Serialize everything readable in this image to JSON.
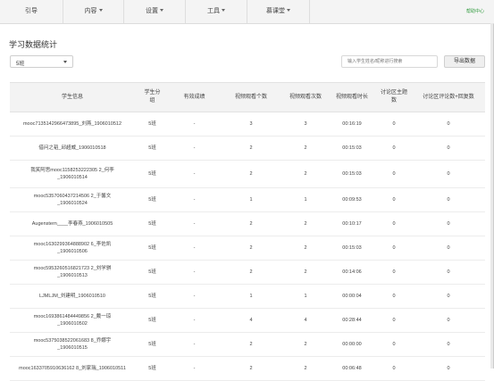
{
  "nav": {
    "items": [
      {
        "label": "引导",
        "dropdown": false
      },
      {
        "label": "内容",
        "dropdown": true
      },
      {
        "label": "设置",
        "dropdown": true
      },
      {
        "label": "工具",
        "dropdown": true
      },
      {
        "label": "慕课堂",
        "dropdown": true
      }
    ],
    "help": "帮助中心"
  },
  "page": {
    "title": "学习数据统计"
  },
  "filter": {
    "class_value": "5班",
    "search_placeholder": "输入学生姓名/昵称进行搜索",
    "export_label": "导出数据"
  },
  "table": {
    "headers": [
      "学生信息",
      "学生分组",
      "有效成绩",
      "视频观看个数",
      "视频观看次数",
      "视频观看时长",
      "讨论区主题数",
      "讨论区评论数+回复数"
    ],
    "rows": [
      {
        "info": "mooc7135142966473895_刘燕_1906010512",
        "group": "5班",
        "score": "-",
        "count": "3",
        "times": "3",
        "duration": "00:16:19",
        "topics": "0",
        "comments": "0"
      },
      {
        "info": "借问之韬_邱超威_1906010518",
        "group": "5班",
        "score": "-",
        "count": "2",
        "times": "2",
        "duration": "00:15:03",
        "topics": "0",
        "comments": "0"
      },
      {
        "info": "我笑阿思mooc1158253222305 2_何李_1906010514",
        "group": "5班",
        "score": "-",
        "count": "2",
        "times": "2",
        "duration": "00:15:03",
        "topics": "0",
        "comments": "0"
      },
      {
        "info": "mooc5357060437214506 2_于馨文_1906010524",
        "group": "5班",
        "score": "-",
        "count": "1",
        "times": "1",
        "duration": "00:09:53",
        "topics": "0",
        "comments": "0"
      },
      {
        "info": "Augenstern____李春燕_1906010505",
        "group": "5班",
        "score": "-",
        "count": "2",
        "times": "2",
        "duration": "00:10:17",
        "topics": "0",
        "comments": "0"
      },
      {
        "info": "mooc1630299364888902 6_李佐凯_1906010506",
        "group": "5班",
        "score": "-",
        "count": "2",
        "times": "2",
        "duration": "00:15:03",
        "topics": "0",
        "comments": "0"
      },
      {
        "info": "mooc5953260516821723 2_刘学骐_1906010513",
        "group": "5班",
        "score": "-",
        "count": "2",
        "times": "2",
        "duration": "00:14:06",
        "topics": "0",
        "comments": "0"
      },
      {
        "info": "LJMLJM_刘建明_1906010510",
        "group": "5班",
        "score": "-",
        "count": "1",
        "times": "1",
        "duration": "00:00:04",
        "topics": "0",
        "comments": "0"
      },
      {
        "info": "mooc1693861484449856 2_戴一琼_1906010502",
        "group": "5班",
        "score": "-",
        "count": "4",
        "times": "4",
        "duration": "00:28:44",
        "topics": "0",
        "comments": "0"
      },
      {
        "info": "mooc5375038522061683 8_乔娜宇_1906010515",
        "group": "5班",
        "score": "-",
        "count": "2",
        "times": "2",
        "duration": "00:00:00",
        "topics": "0",
        "comments": "0"
      },
      {
        "info": "mooc1633705910636162 8_刘家瑞_1906010511",
        "group": "5班",
        "score": "-",
        "count": "2",
        "times": "2",
        "duration": "00:06:48",
        "topics": "0",
        "comments": "0"
      }
    ]
  }
}
